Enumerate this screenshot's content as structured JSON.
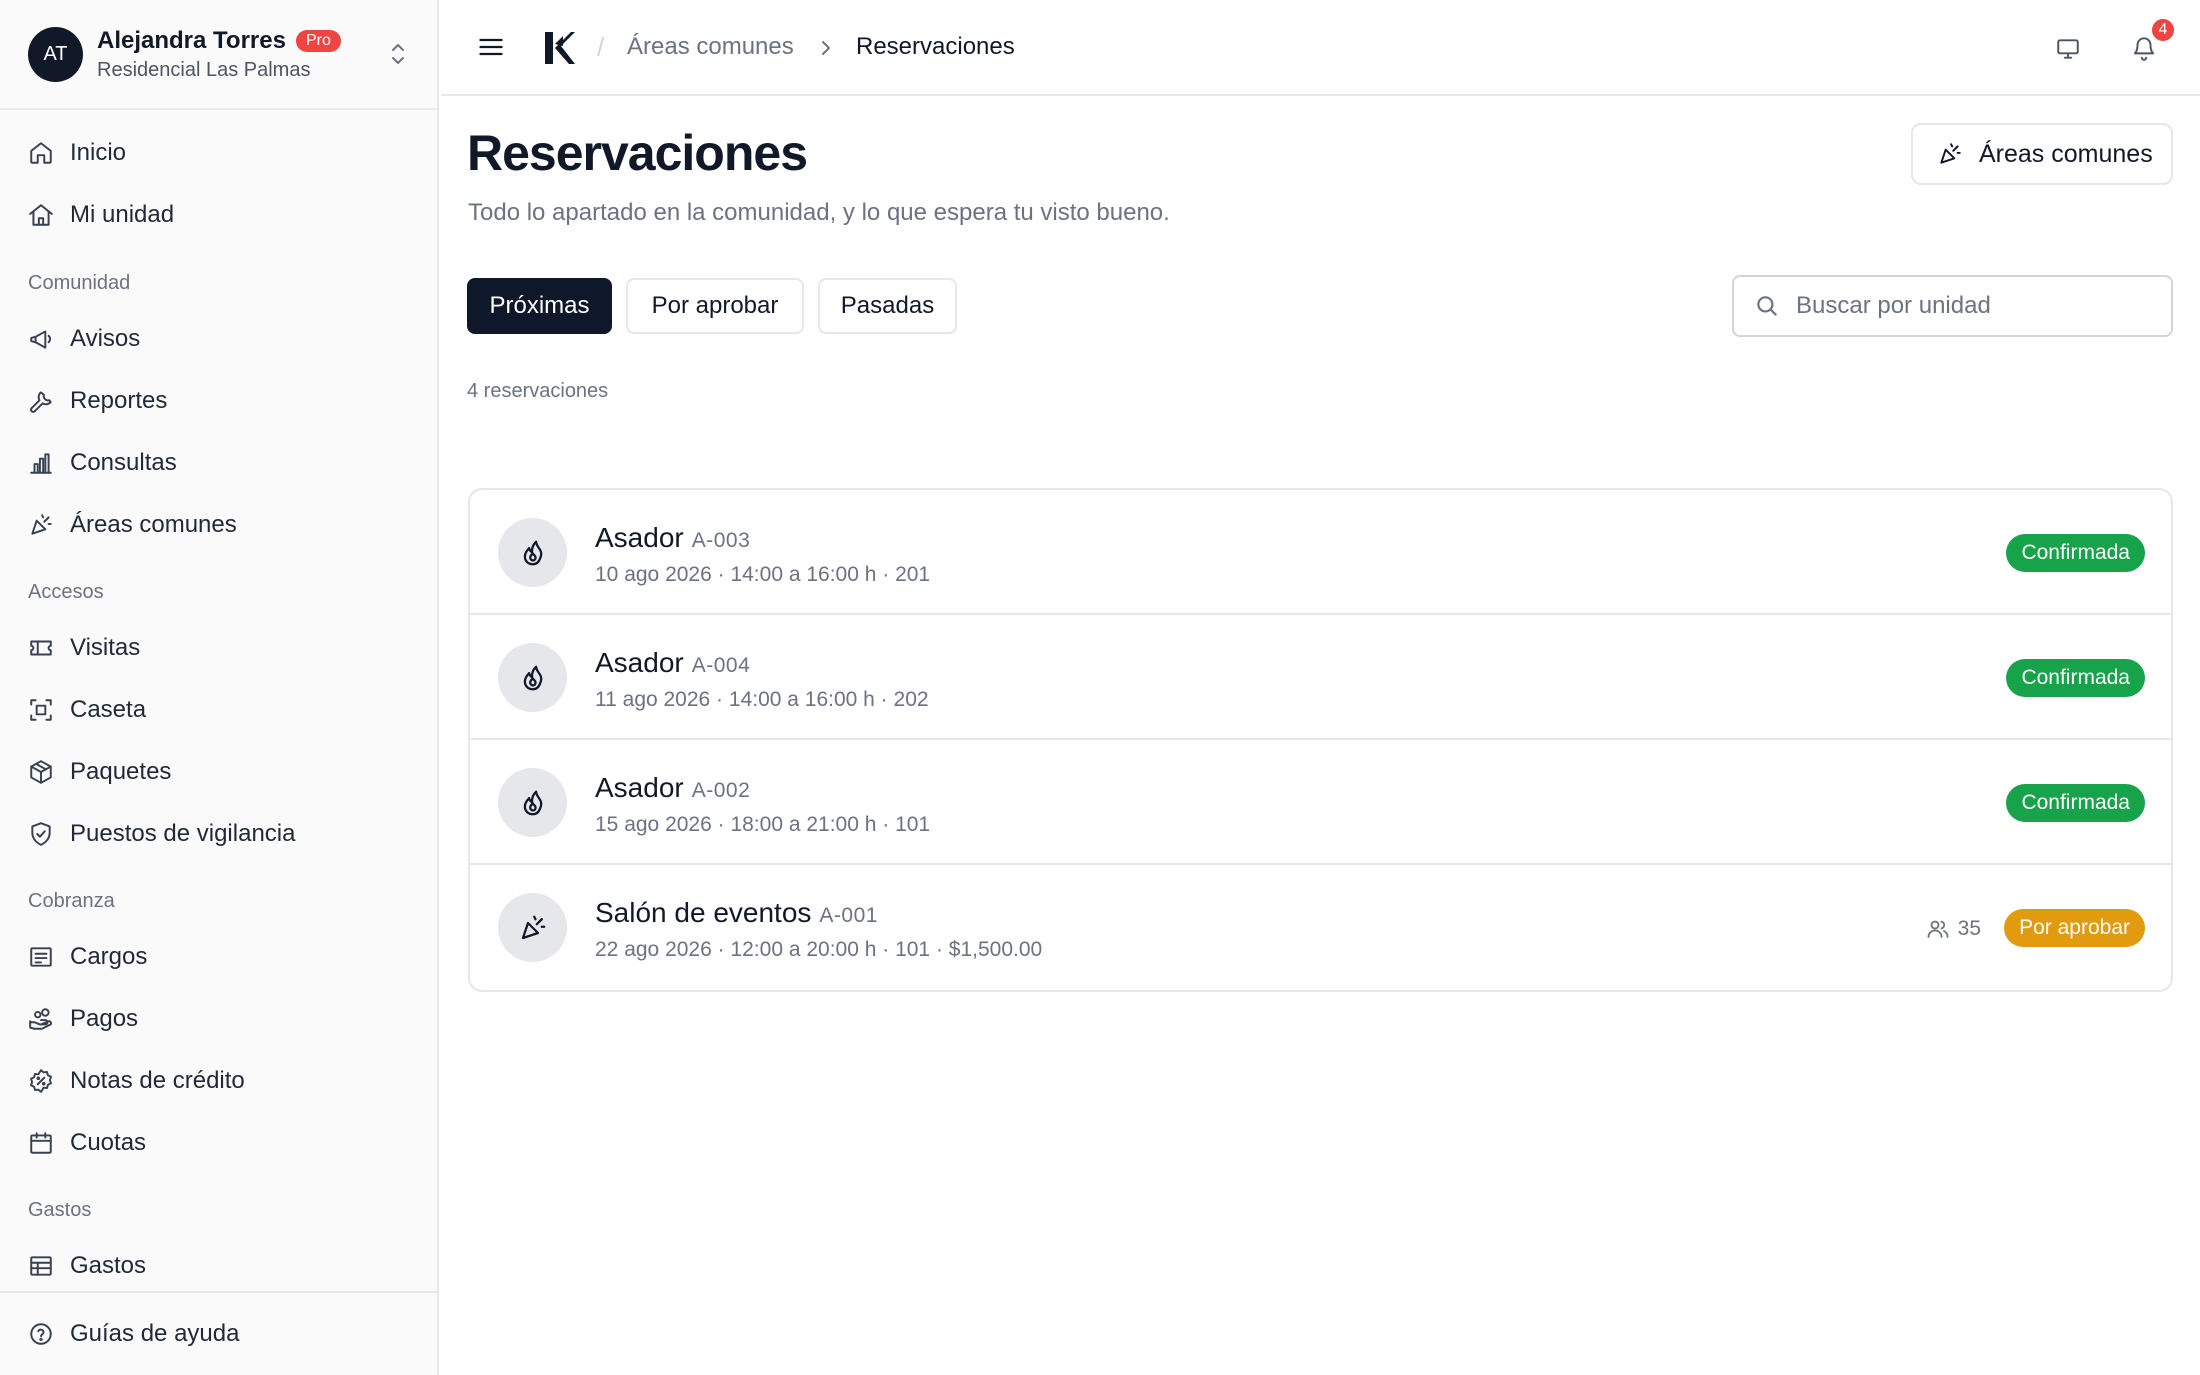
{
  "account": {
    "initials": "AT",
    "name": "Alejandra Torres",
    "plan": "Pro",
    "organization": "Residencial Las Palmas"
  },
  "sidebar": {
    "items": [
      {
        "label": "Inicio",
        "icon": "home-icon"
      },
      {
        "label": "Mi unidad",
        "icon": "house-icon"
      },
      {
        "label": "Avisos",
        "icon": "megaphone-icon"
      },
      {
        "label": "Reportes",
        "icon": "wrench-icon"
      },
      {
        "label": "Consultas",
        "icon": "bar-chart-icon"
      },
      {
        "label": "Áreas comunes",
        "icon": "party-popper-icon"
      },
      {
        "label": "Visitas",
        "icon": "ticket-icon"
      },
      {
        "label": "Caseta",
        "icon": "scan-icon"
      },
      {
        "label": "Paquetes",
        "icon": "package-icon"
      },
      {
        "label": "Puestos de vigilancia",
        "icon": "shield-check-icon"
      },
      {
        "label": "Cargos",
        "icon": "receipt-icon"
      },
      {
        "label": "Pagos",
        "icon": "hand-coins-icon"
      },
      {
        "label": "Notas de crédito",
        "icon": "badge-percent-icon"
      },
      {
        "label": "Cuotas",
        "icon": "calendar-icon"
      },
      {
        "label": "Gastos",
        "icon": "spreadsheet-icon"
      }
    ],
    "sections": {
      "comunidad": "Comunidad",
      "accesos": "Accesos",
      "cobranza": "Cobranza",
      "gastos": "Gastos"
    },
    "footer_item": {
      "label": "Guías de ayuda",
      "icon": "help-circle-icon"
    }
  },
  "topbar": {
    "breadcrumb_parent": "Áreas comunes",
    "breadcrumb_current": "Reservaciones",
    "notification_count": "4"
  },
  "page": {
    "title": "Reservaciones",
    "subtitle": "Todo lo apartado en la comunidad, y lo que espera tu visto bueno.",
    "action_button": "Áreas comunes",
    "tabs": [
      {
        "label": "Próximas",
        "active": true
      },
      {
        "label": "Por aprobar",
        "active": false
      },
      {
        "label": "Pasadas",
        "active": false
      }
    ],
    "search_placeholder": "Buscar por unidad",
    "count_label": "4 reservaciones"
  },
  "reservations": [
    {
      "name": "Asador",
      "code": "A-003",
      "meta": "10 ago 2026 · 14:00 a 16:00 h · 201",
      "status": "Confirmada",
      "icon": "flame-icon"
    },
    {
      "name": "Asador",
      "code": "A-004",
      "meta": "11 ago 2026 · 14:00 a 16:00 h · 202",
      "status": "Confirmada",
      "icon": "flame-icon"
    },
    {
      "name": "Asador",
      "code": "A-002",
      "meta": "15 ago 2026 · 18:00 a 21:00 h · 101",
      "status": "Confirmada",
      "icon": "flame-icon"
    },
    {
      "name": "Salón de eventos",
      "code": "A-001",
      "meta": "22 ago 2026 · 12:00 a 20:00 h · 101 · $1,500.00",
      "status": "Por aprobar",
      "guests": "35",
      "icon": "party-popper-icon"
    }
  ],
  "colors": {
    "primary_dark": "#0f172a",
    "confirmed": "#16a34a",
    "pending": "#e29a0e",
    "danger": "#ef4444"
  }
}
